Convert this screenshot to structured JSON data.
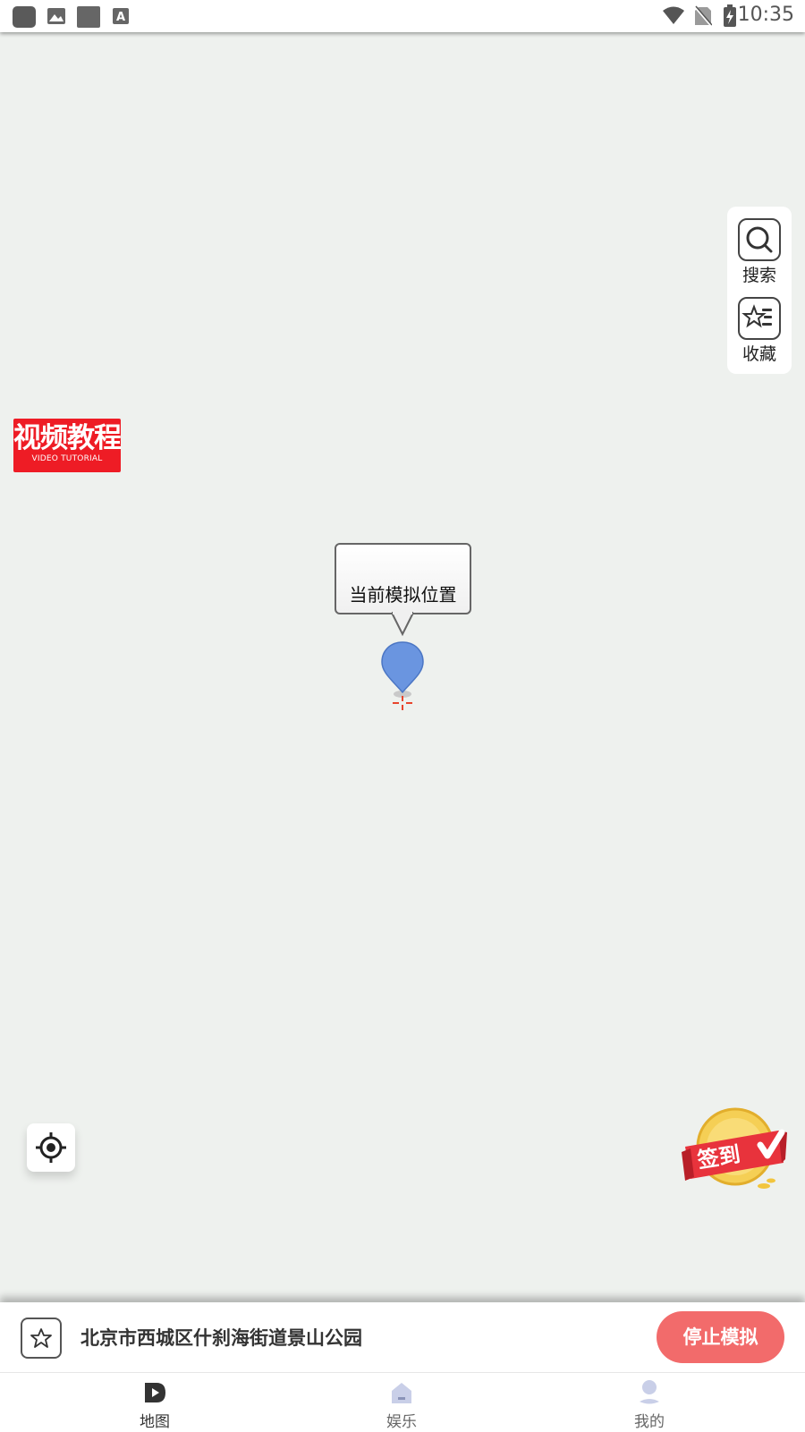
{
  "status_bar": {
    "time": "10:35",
    "left_icons": [
      "app-icon",
      "image-icon",
      "app-icon",
      "font-icon"
    ],
    "right_icons": [
      "wifi-icon",
      "no-sim-icon",
      "battery-charging-icon"
    ]
  },
  "tools": {
    "search_label": "搜索",
    "favorites_label": "收藏"
  },
  "video_badge": {
    "title": "视频教程",
    "subtitle": "VIDEO TUTORIAL"
  },
  "map": {
    "callout_text": "当前模拟位置",
    "pin_color": "#6a95e0"
  },
  "checkin": {
    "label": "签到"
  },
  "location_bar": {
    "address": "北京市西城区什刹海街道景山公园",
    "stop_label": "停止模拟",
    "stop_color": "#f26b6b"
  },
  "nav": {
    "items": [
      {
        "label": "地图",
        "active": true
      },
      {
        "label": "娱乐",
        "active": false
      },
      {
        "label": "我的",
        "active": false
      }
    ],
    "active_color": "#333333",
    "inactive_color": "#666666"
  }
}
